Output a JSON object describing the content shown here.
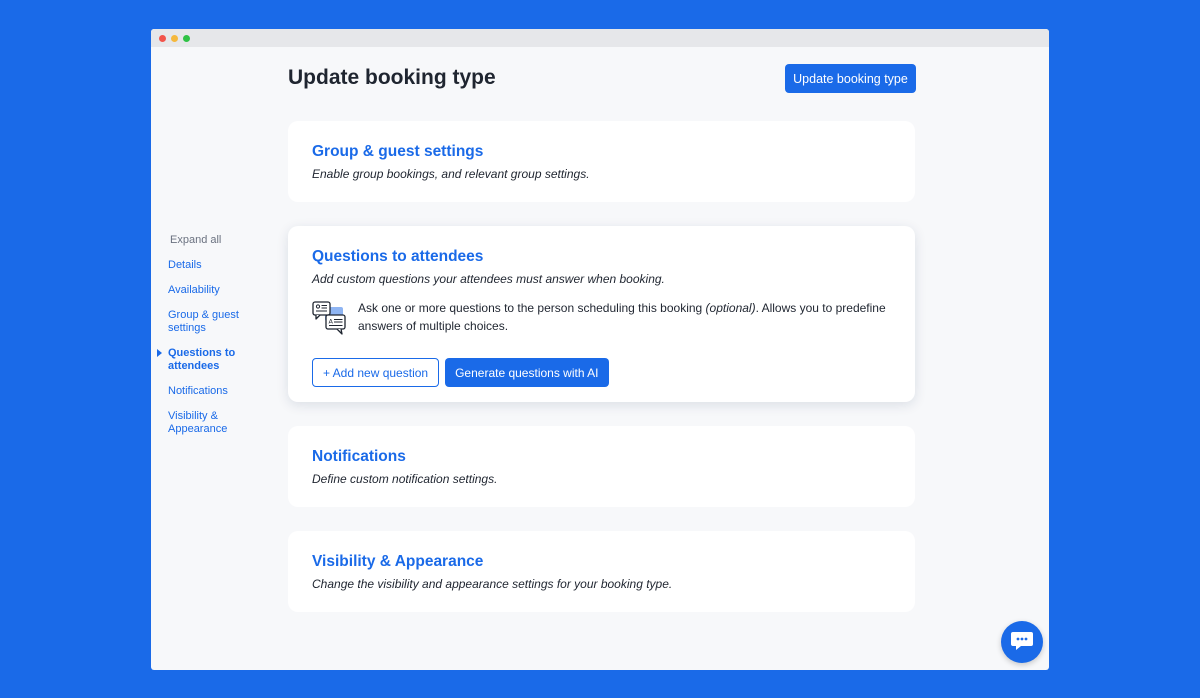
{
  "header": {
    "title": "Update booking type",
    "primary_button": "Update booking type"
  },
  "sidenav": {
    "expand_all": "Expand all",
    "items": [
      {
        "label": "Details"
      },
      {
        "label": "Availability"
      },
      {
        "label": "Group & guest settings"
      },
      {
        "label": "Questions to attendees",
        "active": true
      },
      {
        "label": "Notifications"
      },
      {
        "label": "Visibility & Appearance"
      }
    ]
  },
  "cards": {
    "group": {
      "title": "Group & guest settings",
      "description": "Enable group bookings, and relevant group settings."
    },
    "questions": {
      "title": "Questions to attendees",
      "description": "Add custom questions your attendees must answer when booking.",
      "info_before": "Ask one or more questions to the person scheduling this booking ",
      "info_italic": "(optional)",
      "info_after": ". Allows you to predefine answers of multiple choices.",
      "icon": "questions-chat-icon",
      "add_button": "+ Add new question",
      "ai_button": "Generate questions with AI"
    },
    "notifications": {
      "title": "Notifications",
      "description": "Define custom notification settings."
    },
    "visibility": {
      "title": "Visibility & Appearance",
      "description": "Change the visibility and appearance settings for your booking type."
    }
  },
  "chat_widget": {
    "icon": "chat-bubble-icon"
  },
  "colors": {
    "accent": "#1a6ae8",
    "background": "#1a6ae8",
    "window": "#f7f8fa"
  }
}
